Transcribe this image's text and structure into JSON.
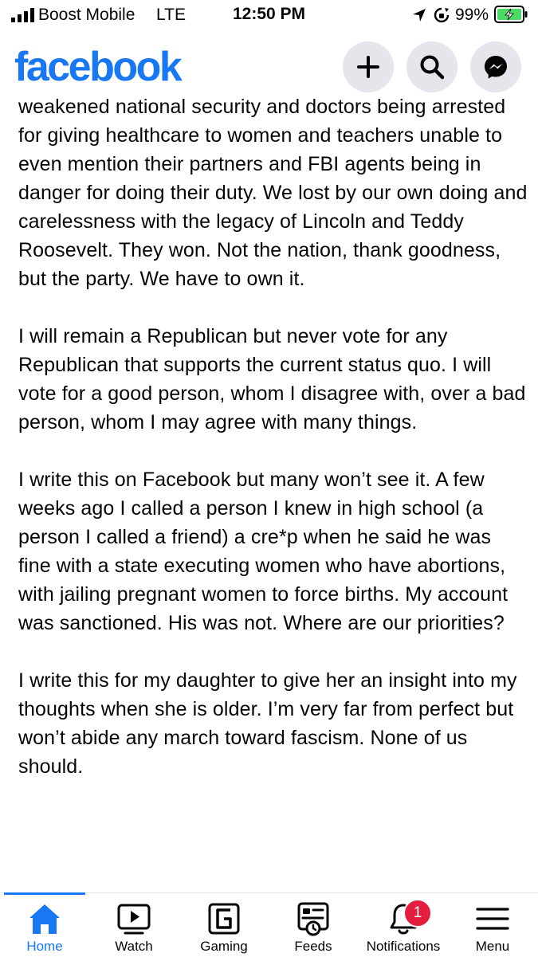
{
  "status_bar": {
    "carrier": "Boost Mobile",
    "network": "LTE",
    "time": "12:50 PM",
    "battery": "99%"
  },
  "header": {
    "logo": "facebook",
    "buttons": [
      {
        "name": "create",
        "icon": "plus-icon"
      },
      {
        "name": "search",
        "icon": "search-icon"
      },
      {
        "name": "messenger",
        "icon": "messenger-icon"
      }
    ]
  },
  "post": {
    "paragraphs": [
      "weakened national security and doctors being arrested for giving healthcare to women and teachers unable to even mention their partners and FBI agents being in danger for doing their duty. We lost by our own doing and carelessness with the legacy of Lincoln and Teddy Roosevelt. They won. Not the nation, thank goodness, but the party. We have to own it.",
      "I will remain a Republican but never vote for any Republican that supports the current status quo. I will vote for a good person, whom I disagree with, over a bad person, whom I may agree with many things.",
      "I write this on Facebook but many won’t see it. A few weeks ago I called a person I knew in high school (a person I called a friend) a cre*p when he said he was fine with a state executing women who have abortions, with jailing pregnant women to force births. My account was sanctioned. His was not. Where are our priorities?",
      "I write this for my daughter to give her an insight into my thoughts when she is older. I’m very far from perfect but won’t abide any march toward fascism. None of us should."
    ]
  },
  "tabbar": {
    "tabs": [
      {
        "label": "Home",
        "icon": "home-icon",
        "active": true
      },
      {
        "label": "Watch",
        "icon": "watch-icon",
        "active": false
      },
      {
        "label": "Gaming",
        "icon": "gaming-icon",
        "active": false
      },
      {
        "label": "Feeds",
        "icon": "feeds-icon",
        "active": false
      },
      {
        "label": "Notifications",
        "icon": "bell-icon",
        "active": false
      },
      {
        "label": "Menu",
        "icon": "menu-icon",
        "active": false
      }
    ],
    "notifications_badge": "1"
  },
  "colors": {
    "brand": "#1877f2",
    "badge": "#e41e3f",
    "battery": "#4cd964"
  }
}
